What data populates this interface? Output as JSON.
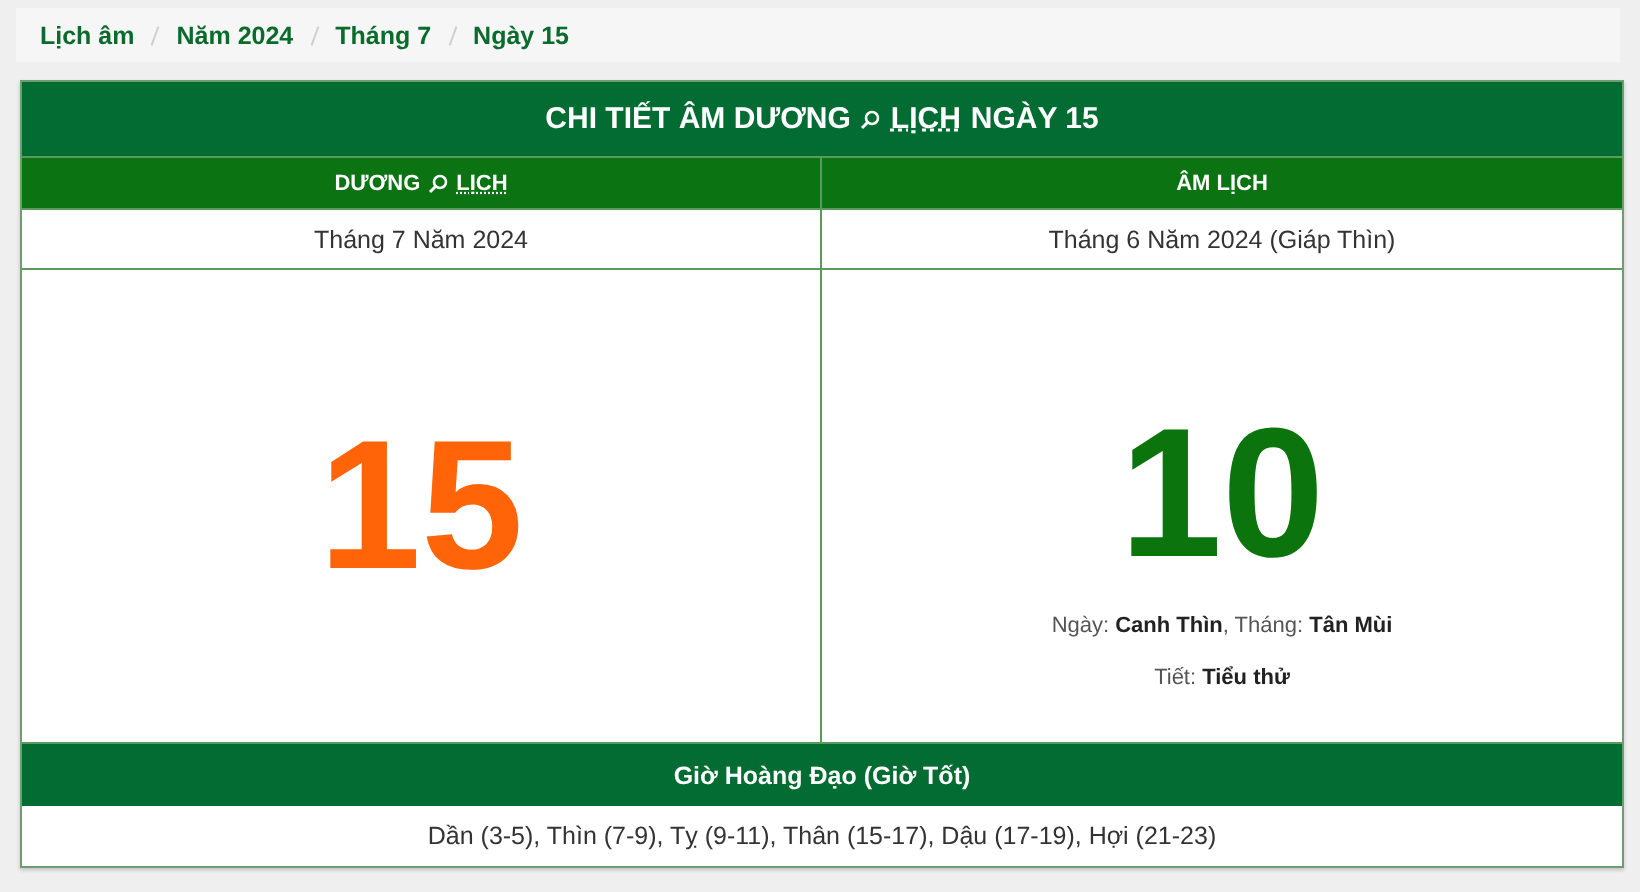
{
  "breadcrumb": [
    {
      "label": "Lịch âm"
    },
    {
      "label": "Năm 2024"
    },
    {
      "label": "Tháng 7"
    },
    {
      "label": "Ngày 15"
    }
  ],
  "title": {
    "before": "CHI TIẾT ÂM DƯƠNG",
    "link": "LỊCH",
    "after": "NGÀY 15"
  },
  "solar": {
    "heading_before": "DƯƠNG",
    "heading_link": "LỊCH",
    "month": "Tháng 7 Năm 2024",
    "day": "15"
  },
  "lunar": {
    "heading": "ÂM LỊCH",
    "month": "Tháng 6 Năm 2024 (Giáp Thìn)",
    "day": "10",
    "details": [
      "Ngày: **Canh Thìn**, Tháng: **Tân Mùi**",
      "Tiết: **Tiểu thử**"
    ]
  },
  "good_hours": {
    "heading": "Giờ Hoàng Đạo (Giờ Tốt)",
    "hours": "Dần (3-5), Thìn (7-9), Tỵ (9-11), Thân (15-17), Dậu (17-19), Hợi (21-23)"
  }
}
